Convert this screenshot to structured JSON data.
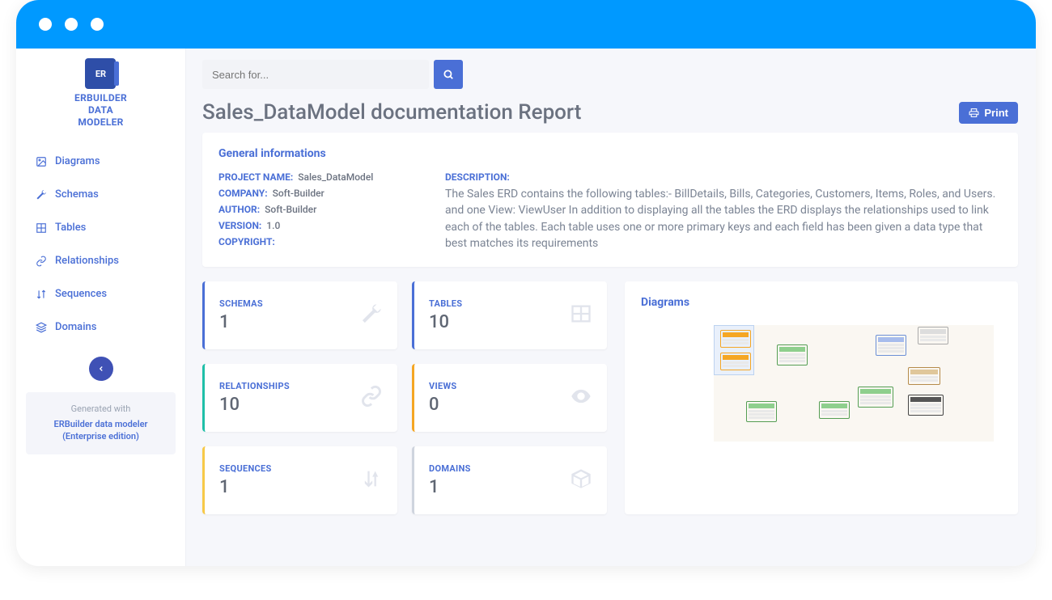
{
  "brand": {
    "icon_text": "ER",
    "line1": "ERBUILDER",
    "line2": "DATA",
    "line3": "MODELER"
  },
  "sidebar": {
    "items": [
      {
        "label": "Diagrams"
      },
      {
        "label": "Schemas"
      },
      {
        "label": "Tables"
      },
      {
        "label": "Relationships"
      },
      {
        "label": "Sequences"
      },
      {
        "label": "Domains"
      }
    ],
    "generated_label": "Generated with",
    "generated_value": "ERBuilder data modeler (Enterprise edition)"
  },
  "search": {
    "placeholder": "Search for..."
  },
  "page": {
    "title": "Sales_DataModel documentation Report",
    "print_label": "Print"
  },
  "general": {
    "heading": "General informations",
    "project_name_label": "PROJECT NAME:",
    "project_name": "Sales_DataModel",
    "company_label": "COMPANY:",
    "company": "Soft-Builder",
    "author_label": "AUTHOR:",
    "author": "Soft-Builder",
    "version_label": "VERSION:",
    "version": "1.0",
    "copyright_label": "COPYRIGHT:",
    "copyright": "",
    "description_label": "DESCRIPTION:",
    "description": "The Sales ERD contains the following tables:- BillDetails, Bills, Categories, Customers, Items, Roles, and Users. and one View: ViewUser In addition to displaying all the tables the ERD displays the relationships used to link each of the tables. Each table uses one or more primary keys and each field has been given a data type that best matches its requirements"
  },
  "stats": {
    "schemas": {
      "label": "SCHEMAS",
      "value": "1"
    },
    "tables": {
      "label": "TABLES",
      "value": "10"
    },
    "relationships": {
      "label": "RELATIONSHIPS",
      "value": "10"
    },
    "views": {
      "label": "VIEWS",
      "value": "0"
    },
    "sequences": {
      "label": "SEQUENCES",
      "value": "1"
    },
    "domains": {
      "label": "DOMAINS",
      "value": "1"
    }
  },
  "diagrams_panel": {
    "heading": "Diagrams"
  }
}
